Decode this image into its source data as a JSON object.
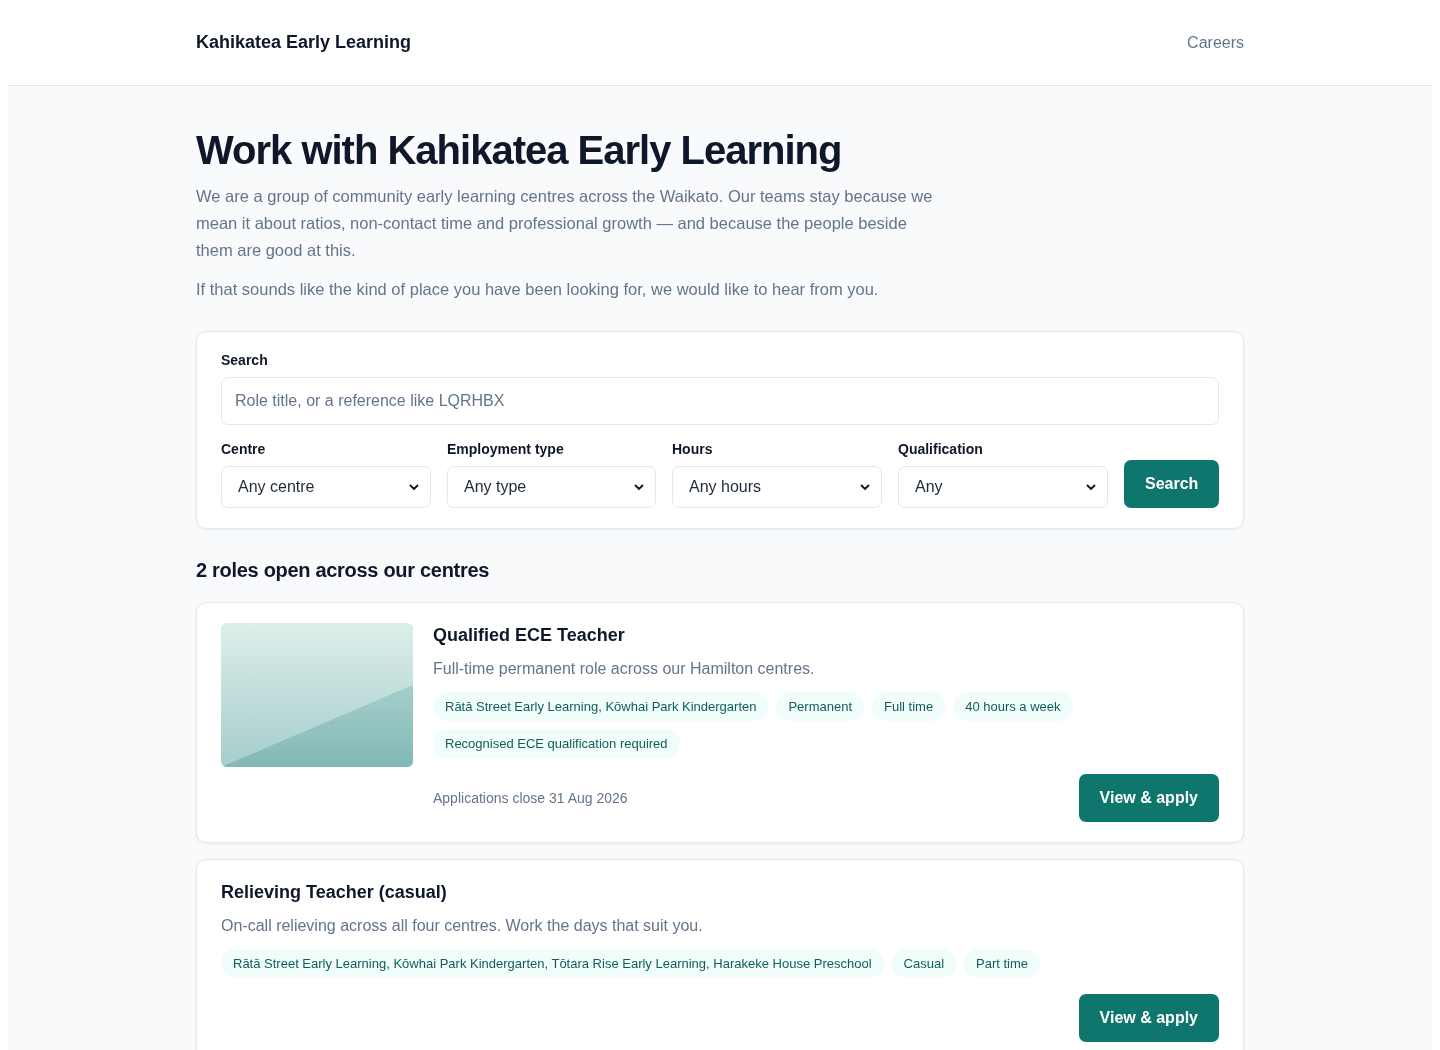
{
  "header": {
    "brand": "Kahikatea Early Learning",
    "nav": [
      {
        "label": "Careers"
      }
    ]
  },
  "intro": {
    "title": "Work with Kahikatea Early Learning",
    "paragraphs": [
      "We are a group of community early learning centres across the Waikato. Our teams stay because we mean it about ratios, non-contact time and professional growth — and because the people beside them are good at this.",
      "If that sounds like the kind of place you have been looking for, we would like to hear from you."
    ]
  },
  "search": {
    "label": "Search",
    "placeholder": "Role title, or a reference like LQRHBX",
    "filters": [
      {
        "label": "Centre",
        "value": "Any centre"
      },
      {
        "label": "Employment type",
        "value": "Any type"
      },
      {
        "label": "Hours",
        "value": "Any hours"
      },
      {
        "label": "Qualification",
        "value": "Any"
      }
    ],
    "button": "Search"
  },
  "results_heading": "2 roles open across our centres",
  "jobs": [
    {
      "title": "Qualified ECE Teacher",
      "summary": "Full-time permanent role across our Hamilton centres.",
      "tags": [
        "Rātā Street Early Learning, Kōwhai Park Kindergarten",
        "Permanent",
        "Full time",
        "40 hours a week",
        "Recognised ECE qualification required"
      ],
      "closing": "Applications close 31 Aug 2026",
      "button": "View & apply"
    },
    {
      "title": "Relieving Teacher (casual)",
      "summary": "On-call relieving across all four centres. Work the days that suit you.",
      "tags": [
        "Rātā Street Early Learning, Kōwhai Park Kindergarten, Tōtara Rise Early Learning, Harakeke House Preschool",
        "Casual",
        "Part time"
      ],
      "button": "View & apply"
    }
  ]
}
